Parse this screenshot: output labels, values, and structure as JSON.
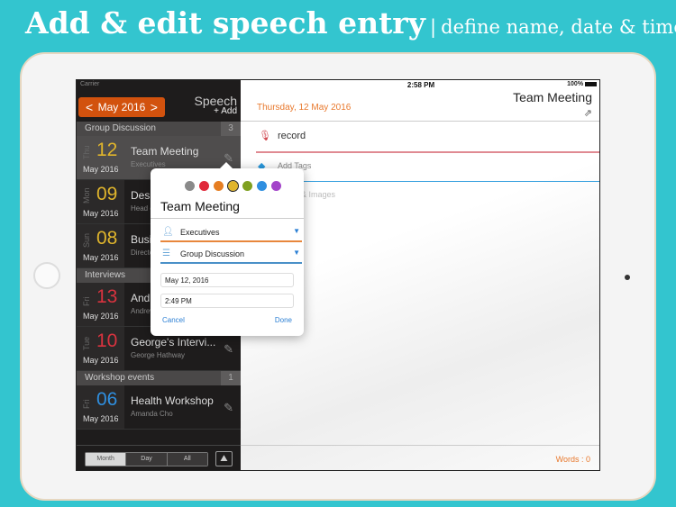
{
  "headline": {
    "main": "Add & edit speech entry",
    "separator": "|",
    "tagline": "define name, date & time."
  },
  "status": {
    "carrier": "Carrier",
    "time": "2:58 PM",
    "battery": "100%"
  },
  "sidebar": {
    "month_nav": {
      "prev": "<",
      "label": "May 2016",
      "next": ">"
    },
    "app_title": "Speech",
    "add_label": "+ Add",
    "sections": [
      {
        "name": "Group Discussion",
        "count": "3",
        "entries": [
          {
            "dow": "Thu",
            "day": "12",
            "month_year": "May 2016",
            "title": "Team Meeting",
            "subtitle": "Executives",
            "color": "#e0b52c",
            "selected": true
          },
          {
            "dow": "Mon",
            "day": "09",
            "month_year": "May 2016",
            "title": "Design Meeting",
            "subtitle": "Head of Design",
            "color": "#e0b52c"
          },
          {
            "dow": "Sun",
            "day": "08",
            "month_year": "May 2016",
            "title": "Business Plan",
            "subtitle": "Directors",
            "color": "#e0b52c"
          }
        ]
      },
      {
        "name": "Interviews",
        "count": "",
        "entries": [
          {
            "dow": "Fri",
            "day": "13",
            "month_year": "May 2016",
            "title": "Andrew's Interview",
            "subtitle": "Andrew",
            "color": "#d9333f"
          },
          {
            "dow": "Tue",
            "day": "10",
            "month_year": "May 2016",
            "title": "George's Intervi...",
            "subtitle": "George Hathway",
            "color": "#d9333f"
          }
        ]
      },
      {
        "name": "Workshop events",
        "count": "1",
        "entries": [
          {
            "dow": "Fri",
            "day": "06",
            "month_year": "May 2016",
            "title": "Health Workshop",
            "subtitle": "Amanda Cho",
            "color": "#2f8fe0"
          }
        ]
      }
    ],
    "view_modes": [
      "Month",
      "Day",
      "All"
    ],
    "active_view": "Month"
  },
  "main": {
    "date": "Thursday, 12 May 2016",
    "title": "Team Meeting",
    "record_label": "record",
    "tags_placeholder": "Add Tags",
    "notes_placeholder": "Notes & Images",
    "words": "Words : 0"
  },
  "popover": {
    "colors": [
      "#8a8a8a",
      "#e0283a",
      "#e67e22",
      "#e0b52c",
      "#7fa020",
      "#2f8fe0",
      "#a344c9"
    ],
    "selected_color": "#e0b52c",
    "title": "Team Meeting",
    "speaker": "Executives",
    "category": "Group Discussion",
    "date": "May 12, 2016",
    "time": "2:49 PM",
    "cancel": "Cancel",
    "done": "Done"
  }
}
